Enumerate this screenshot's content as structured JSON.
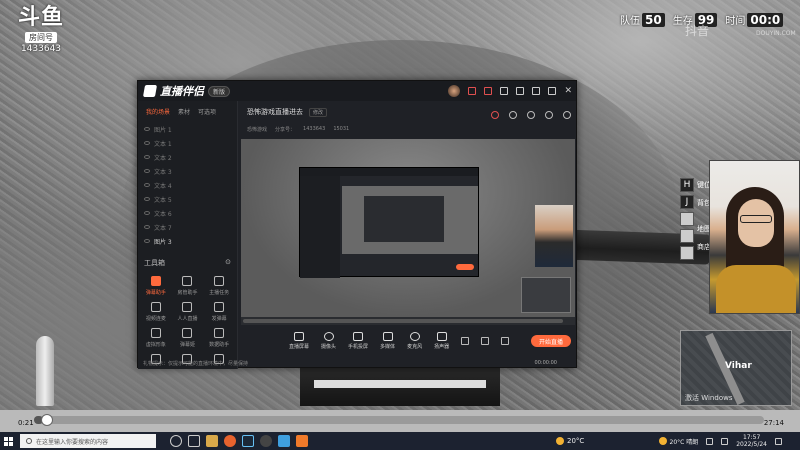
{
  "overlay": {
    "douyu_logo": "斗鱼",
    "room_tag": "房间号",
    "room_number": "1433643"
  },
  "hud": {
    "squad_label": "队伍",
    "squad_value": "50",
    "alive_label": "生存",
    "alive_value": "99",
    "time_label": "时间",
    "time_value": "00:0",
    "watermark": "抖音",
    "watermark_url": "DOUYIN.COM"
  },
  "app": {
    "name": "直播伴侣",
    "version_badge": "新版",
    "sidebar_tabs": [
      "我的场景",
      "素材",
      "可选项"
    ],
    "scenes": [
      "图片 1",
      "文本 1",
      "文本 2",
      "文本 3",
      "文本 4",
      "文本 5",
      "文本 6",
      "文本 7",
      "图片 3"
    ],
    "toolbox_title": "工具箱",
    "tools": [
      {
        "label": "弹幕助手",
        "hot": true
      },
      {
        "label": "房管助手",
        "hot": false
      },
      {
        "label": "主播任务",
        "hot": false
      },
      {
        "label": "视频连麦",
        "hot": false
      },
      {
        "label": "人人直播",
        "hot": false
      },
      {
        "label": "发弹幕",
        "hot": false
      },
      {
        "label": "虚拟形象",
        "hot": false
      },
      {
        "label": "弹幕姬",
        "hot": false
      },
      {
        "label": "数据助手",
        "hot": false
      },
      {
        "label": "",
        "hot": false
      },
      {
        "label": "",
        "hot": false
      },
      {
        "label": "",
        "hot": false
      }
    ],
    "room_title": "恐怖游戏直播进去",
    "room_edit_label": "修改",
    "room_info": [
      "恐怖游戏",
      "分享号：",
      "1433643",
      "15031"
    ],
    "bottom_controls": [
      "直播屏幕",
      "摄像头",
      "手机投屏",
      "多媒体",
      "麦克风",
      "扬声器"
    ],
    "go_live_label": "开始直播",
    "status_notice": "礼物提示：仅提示可能的直播环境中，尽量保持",
    "status_items": [
      "",
      "",
      "",
      "",
      ""
    ],
    "status_time": "00:00:00"
  },
  "side_keys": [
    "H",
    "J",
    "",
    "",
    ""
  ],
  "side_labels": [
    "键位",
    "背包",
    "",
    "地图",
    "商店"
  ],
  "minimap": {
    "place": "Vihar",
    "hint": "激活 Windows"
  },
  "player": {
    "current_time": "0:21",
    "total_time": "27:14",
    "progress": 0.013
  },
  "taskbar": {
    "search_placeholder": "在这里输入你要搜索的内容",
    "weather_mid": "20°C",
    "weather_right": "20°C 晴朗",
    "clock_time": "17:57",
    "clock_date": "2022/5/24"
  }
}
